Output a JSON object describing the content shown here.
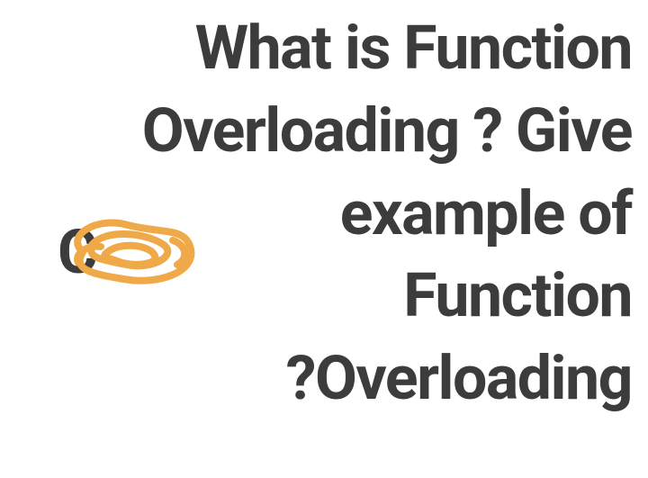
{
  "question": {
    "text": "What is Function\nOverloading ? Give\nexample of\nFunction\n?Overloading"
  },
  "scribble": {
    "color": "#f0a948",
    "underlying_char": "C"
  }
}
